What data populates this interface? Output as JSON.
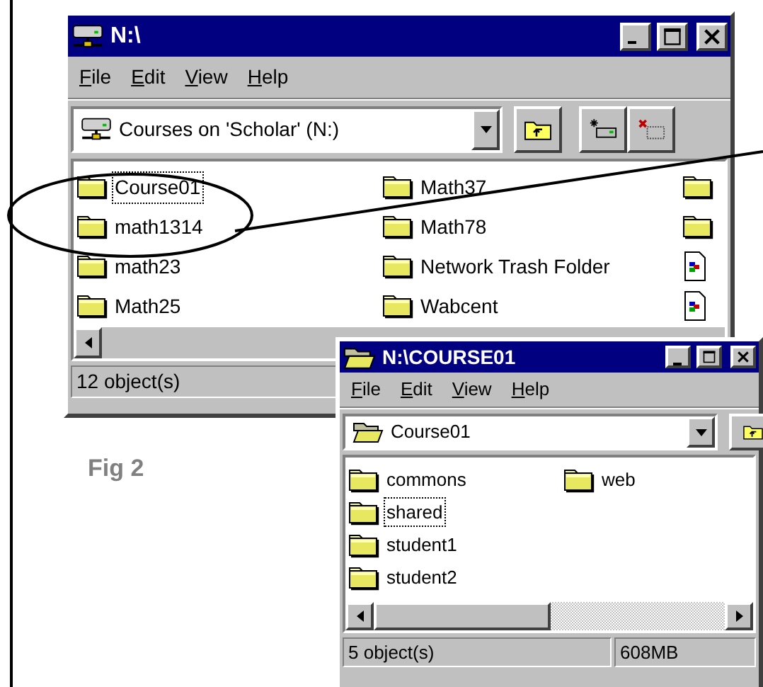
{
  "windows": [
    {
      "kind": "drive",
      "title": "N:\\",
      "menu": [
        "File",
        "Edit",
        "View",
        "Help"
      ],
      "address": "Courses on 'Scholar' (N:)",
      "toolbar": [
        {
          "kind": "up"
        },
        {
          "kind": "map-drive"
        },
        {
          "kind": "disconnect"
        }
      ],
      "items": [
        {
          "kind": "folder",
          "label": "Course01",
          "selected": true
        },
        {
          "kind": "folder",
          "label": "math1314",
          "selected": false
        },
        {
          "kind": "folder",
          "label": "math23",
          "selected": false
        },
        {
          "kind": "folder",
          "label": "Math25",
          "selected": false
        },
        {
          "kind": "folder",
          "label": "Math37",
          "selected": false
        },
        {
          "kind": "folder",
          "label": "Math78",
          "selected": false
        },
        {
          "kind": "folder",
          "label": "Network Trash Folder",
          "selected": false
        },
        {
          "kind": "folder",
          "label": "Wabcent",
          "selected": false
        },
        {
          "kind": "folder"
        },
        {
          "kind": "folder"
        },
        {
          "kind": "document"
        },
        {
          "kind": "document"
        }
      ],
      "status": [
        "12 object(s)"
      ]
    },
    {
      "kind": "folder",
      "title": "N:\\COURSE01",
      "menu": [
        "File",
        "Edit",
        "View",
        "Help"
      ],
      "address": "Course01",
      "toolbar": [
        {
          "kind": "up"
        }
      ],
      "items": [
        {
          "kind": "folder",
          "label": "commons",
          "selected": false
        },
        {
          "kind": "folder",
          "label": "shared",
          "selected": true
        },
        {
          "kind": "folder",
          "label": "student1",
          "selected": false
        },
        {
          "kind": "folder",
          "label": "student2",
          "selected": false
        },
        {
          "kind": "folder",
          "label": "web",
          "selected": false
        }
      ],
      "status": [
        "5 object(s)",
        "608MB"
      ]
    }
  ],
  "caption": "Fig 2"
}
